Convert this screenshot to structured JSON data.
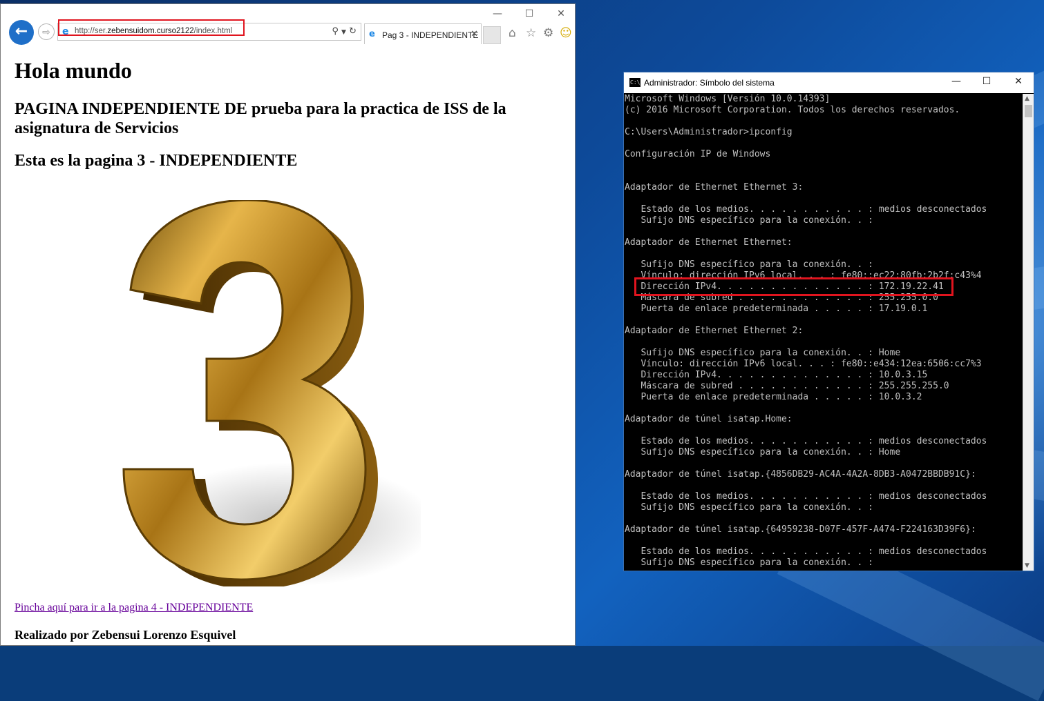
{
  "browser": {
    "url_prefix": "http://ser.",
    "url_domain": "zebensuidom.curso2122",
    "url_path": "/index.html",
    "tab_title": "Pag 3 - INDEPENDIENTE",
    "window_controls": {
      "minimize": "—",
      "maximize": "☐",
      "close": "✕"
    }
  },
  "page": {
    "heading1": "Hola mundo",
    "heading2": "PAGINA INDEPENDIENTE DE prueba para la practica de ISS de la asignatura de Servicios",
    "heading3": "Esta es la pagina 3 - INDEPENDIENTE",
    "link_text": "Pincha aquí para ir a la pagina 4 - INDEPENDIENTE",
    "credit": "Realizado por Zebensui Lorenzo Esquivel"
  },
  "cmd": {
    "icon_text": "C:\\",
    "title": "Administrador: Símbolo del sistema",
    "window_controls": {
      "minimize": "—",
      "maximize": "☐",
      "close": "✕"
    },
    "lines": [
      "Microsoft Windows [Versión 10.0.14393]",
      "(c) 2016 Microsoft Corporation. Todos los derechos reservados.",
      "",
      "C:\\Users\\Administrador>ipconfig",
      "",
      "Configuración IP de Windows",
      "",
      "",
      "Adaptador de Ethernet Ethernet 3:",
      "",
      "   Estado de los medios. . . . . . . . . . . : medios desconectados",
      "   Sufijo DNS específico para la conexión. . :",
      "",
      "Adaptador de Ethernet Ethernet:",
      "",
      "   Sufijo DNS específico para la conexión. . :",
      "   Vínculo: dirección IPv6 local. . . : fe80::ec22:80fb:2b2f:c43%4",
      "   Dirección IPv4. . . . . . . . . . . . . . : 172.19.22.41",
      "   Máscara de subred . . . . . . . . . . . . : 255.255.0.0",
      "   Puerta de enlace predeterminada . . . . . : 17.19.0.1",
      "",
      "Adaptador de Ethernet Ethernet 2:",
      "",
      "   Sufijo DNS específico para la conexión. . : Home",
      "   Vínculo: dirección IPv6 local. . . : fe80::e434:12ea:6506:cc7%3",
      "   Dirección IPv4. . . . . . . . . . . . . . : 10.0.3.15",
      "   Máscara de subred . . . . . . . . . . . . : 255.255.255.0",
      "   Puerta de enlace predeterminada . . . . . : 10.0.3.2",
      "",
      "Adaptador de túnel isatap.Home:",
      "",
      "   Estado de los medios. . . . . . . . . . . : medios desconectados",
      "   Sufijo DNS específico para la conexión. . : Home",
      "",
      "Adaptador de túnel isatap.{4856DB29-AC4A-4A2A-8DB3-A0472BBDB91C}:",
      "",
      "   Estado de los medios. . . . . . . . . . . : medios desconectados",
      "   Sufijo DNS específico para la conexión. . :",
      "",
      "Adaptador de túnel isatap.{64959238-D07F-457F-A474-F224163D39F6}:",
      "",
      "   Estado de los medios. . . . . . . . . . . : medios desconectados",
      "   Sufijo DNS específico para la conexión. . :"
    ]
  },
  "icons": {
    "back": "back-arrow-icon",
    "forward": "forward-arrow-icon",
    "ie": "internet-explorer-icon",
    "home": "home-icon",
    "favorites": "star-icon",
    "tools": "gear-icon",
    "feedback": "smiley-icon"
  },
  "colors": {
    "highlight": "#e0141e",
    "link_visited": "#660099",
    "ie_blue": "#1f6fc8",
    "cmd_bg": "#000000",
    "cmd_text": "#c0c0c0"
  }
}
